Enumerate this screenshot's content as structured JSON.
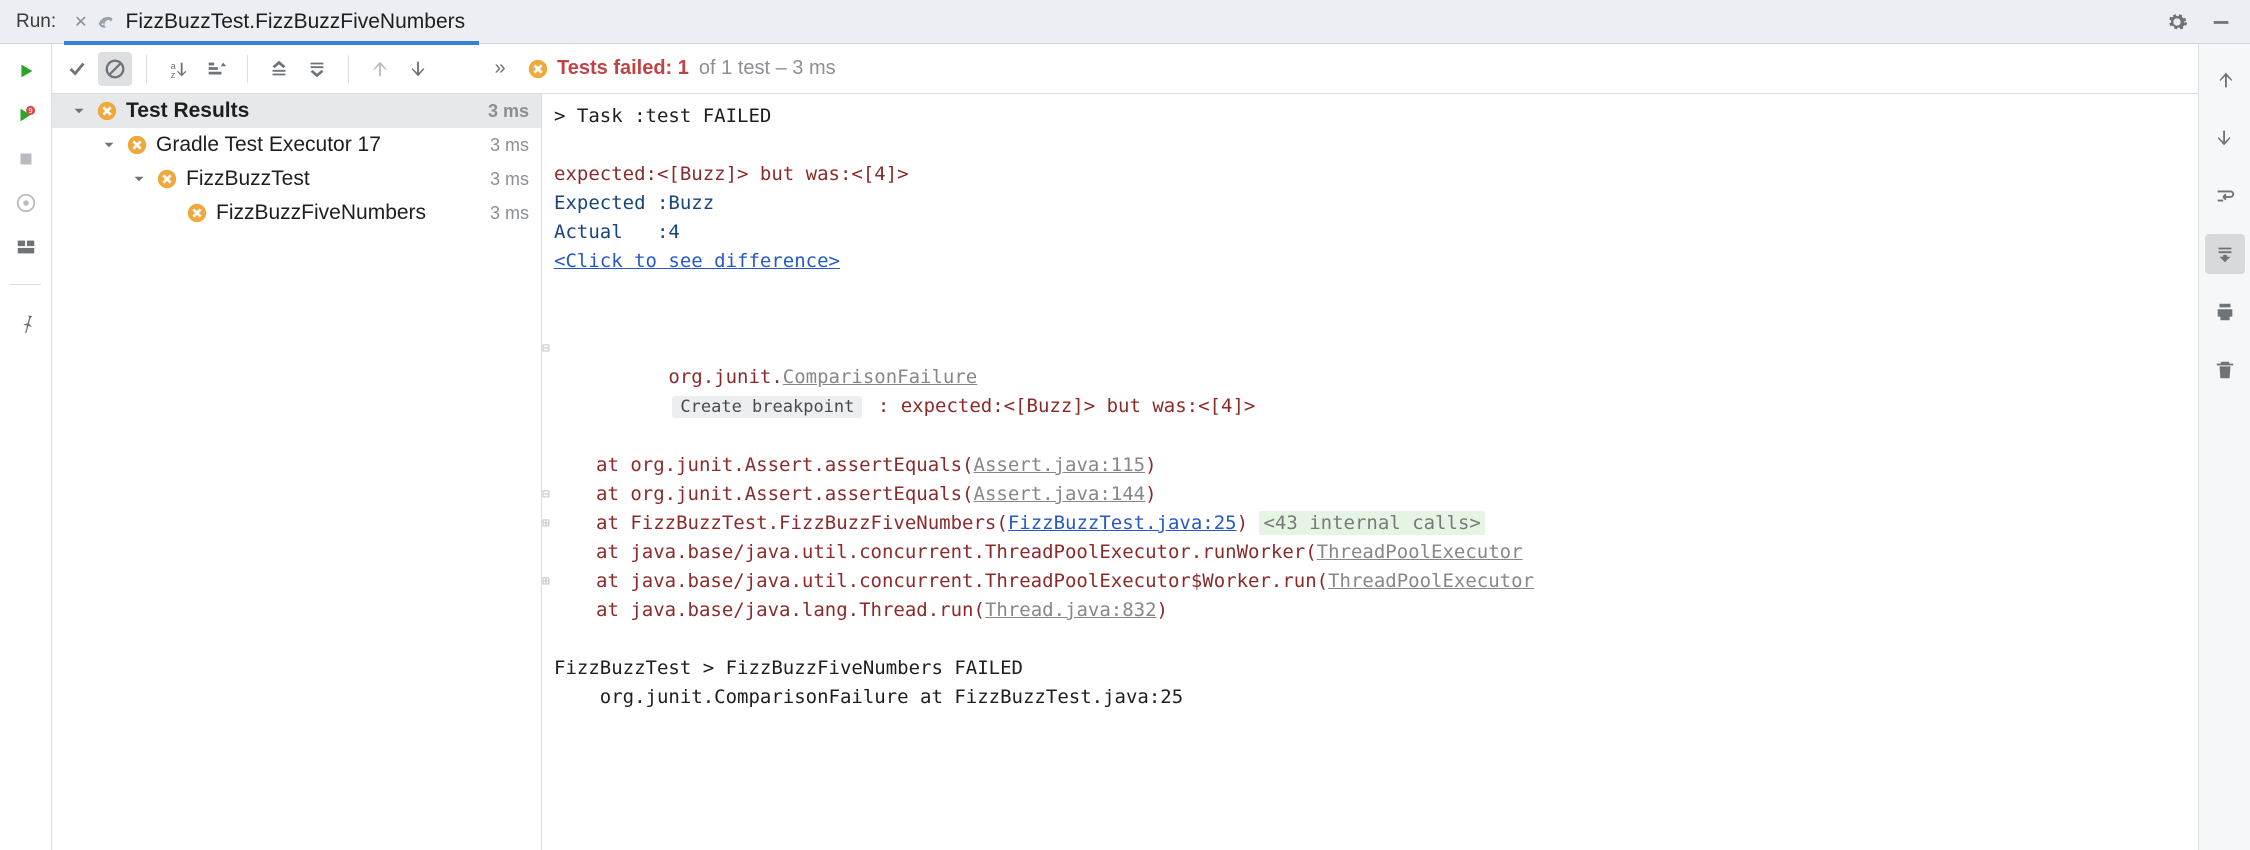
{
  "header": {
    "label": "Run:",
    "tab_title": "FizzBuzzTest.FizzBuzzFiveNumbers"
  },
  "status": {
    "failed_label": "Tests failed: 1",
    "rest": " of 1 test – 3 ms"
  },
  "tree": [
    {
      "level": 0,
      "label": "Test Results",
      "time": "3 ms",
      "head": true,
      "chev": true
    },
    {
      "level": 1,
      "label": "Gradle Test Executor 17",
      "time": "3 ms",
      "chev": true
    },
    {
      "level": 2,
      "label": "FizzBuzzTest",
      "time": "3 ms",
      "chev": true
    },
    {
      "level": 3,
      "label": "FizzBuzzFiveNumbers",
      "time": "3 ms",
      "chev": false
    }
  ],
  "console": {
    "task_line": "> Task :test FAILED",
    "diff_summary": "expected:<[Buzz]> but was:<[4]>",
    "expected_line": "Expected :Buzz",
    "actual_line": "Actual   :4",
    "diff_link": "<Click to see difference>",
    "exc_prefix": "org.junit.",
    "exc_class": "ComparisonFailure",
    "bp_label": "Create breakpoint",
    "exc_msg": " : expected:<[Buzz]> but was:<[4]>",
    "frame1_a": "at org.junit.Assert.assertEquals(",
    "frame1_l": "Assert.java:115",
    "frame2_a": "at org.junit.Assert.assertEquals(",
    "frame2_l": "Assert.java:144",
    "frame3_a": "at FizzBuzzTest.FizzBuzzFiveNumbers(",
    "frame3_l": "FizzBuzzTest.java:25",
    "frame3_tail": "<43 internal calls>",
    "frame4_a": "at java.base/java.util.concurrent.ThreadPoolExecutor.runWorker(",
    "frame4_l": "ThreadPoolExecutor",
    "frame5_a": "at java.base/java.util.concurrent.ThreadPoolExecutor$Worker.run(",
    "frame5_l": "ThreadPoolExecutor",
    "frame6_a": "at java.base/java.lang.Thread.run(",
    "frame6_l": "Thread.java:832",
    "tail1": "FizzBuzzTest > FizzBuzzFiveNumbers FAILED",
    "tail2": "    org.junit.ComparisonFailure at FizzBuzzTest.java:25"
  }
}
